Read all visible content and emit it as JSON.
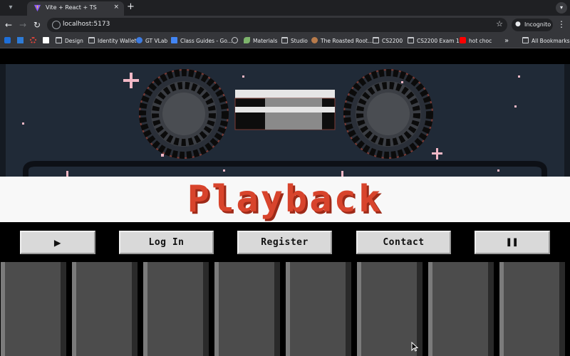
{
  "browser": {
    "tab_title": "Vite + React + TS",
    "tab_close": "×",
    "new_tab": "+",
    "url": "localhost:5173",
    "profile_label": "Incognito",
    "bookmarks": [
      {
        "label": "Design",
        "icon": "folder-icon"
      },
      {
        "label": "Identity Wallet",
        "icon": "folder-icon"
      },
      {
        "label": "GT VLab",
        "icon": "vlab-icon"
      },
      {
        "label": "Class Guides - Go...",
        "icon": "docs-icon"
      },
      {
        "label": "Materials",
        "icon": "leaf-icon"
      },
      {
        "label": "Studio",
        "icon": "folder-icon"
      },
      {
        "label": "The Roasted Root...",
        "icon": "roast-icon"
      },
      {
        "label": "CS2200",
        "icon": "folder-icon"
      },
      {
        "label": "CS2200 Exam 1",
        "icon": "folder-icon"
      },
      {
        "label": "hot choc",
        "icon": "youtube-icon"
      }
    ],
    "all_bookmarks": "All Bookmarks",
    "more_bookmarks": "»"
  },
  "app": {
    "title": "Playback",
    "buttons": {
      "play": "▶",
      "login": "Log In",
      "register": "Register",
      "contact": "Contact",
      "pause": "❚❚"
    }
  },
  "colors": {
    "title_red": "#d8442c",
    "hero_bg": "#202a37",
    "button_face": "#d9d9d9"
  }
}
